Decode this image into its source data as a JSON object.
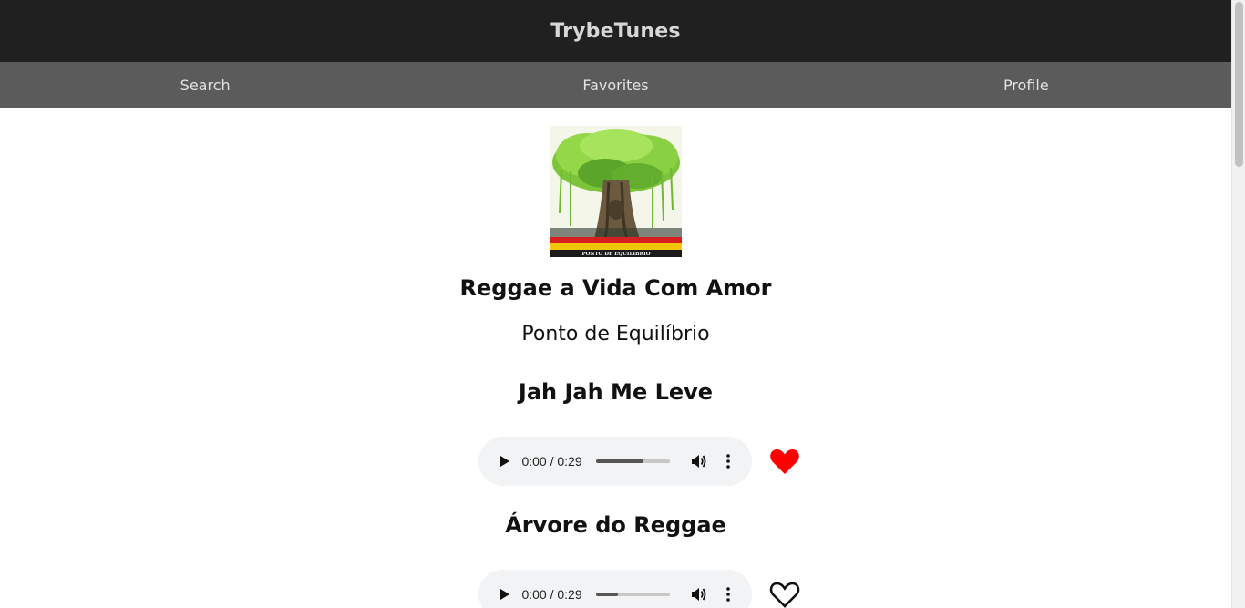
{
  "app": {
    "title": "TrybeTunes"
  },
  "nav": {
    "items": [
      {
        "label": "Search"
      },
      {
        "label": "Favorites"
      },
      {
        "label": "Profile"
      }
    ]
  },
  "album": {
    "name": "Reggae a Vida Com Amor",
    "artist": "Ponto de Equilíbrio",
    "cover": {
      "icon": "album-cover-art",
      "text": "PONTO DE EQUILIBRIO"
    }
  },
  "tracks": [
    {
      "name": "Jah Jah Me Leve",
      "player": {
        "time": "0:00 / 0:29",
        "progress_fraction": 0.65
      },
      "favorite": true,
      "favorite_icon": "heart-filled-icon"
    },
    {
      "name": "Árvore do Reggae",
      "player": {
        "time": "0:00 / 0:29",
        "progress_fraction": 0.3
      },
      "favorite": false,
      "favorite_icon": "heart-outline-icon"
    }
  ],
  "colors": {
    "header_bg": "#202021",
    "nav_bg": "#5b5b5c",
    "favorite": "#ff0000"
  }
}
